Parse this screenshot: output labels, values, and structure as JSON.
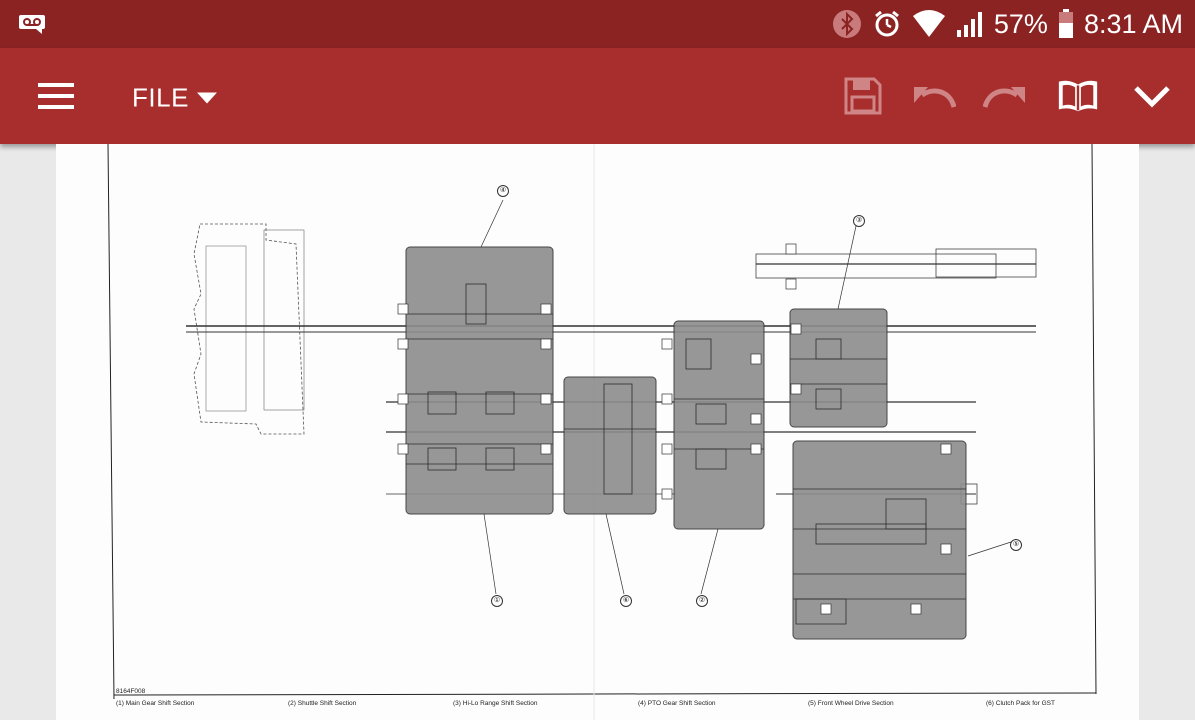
{
  "status_bar": {
    "battery_percent": "57%",
    "time": "8:31 AM",
    "icons": [
      "voicemail-icon",
      "bluetooth-icon",
      "alarm-icon",
      "wifi-icon",
      "signal-icon",
      "battery-icon"
    ]
  },
  "toolbar": {
    "file_label": "FILE",
    "icons": [
      "menu-icon",
      "dropdown-caret-icon",
      "save-icon",
      "undo-icon",
      "redo-icon",
      "book-icon",
      "chevron-down-icon"
    ]
  },
  "document": {
    "figure_code": "8164F008",
    "callouts": [
      "①",
      "②",
      "③",
      "④",
      "⑤",
      "⑥"
    ],
    "captions": [
      "(1)  Main Gear Shift Section",
      "(2)  Shuttle Shift Section",
      "(3)  Hi-Lo Range Shift Section",
      "(4)  PTO Gear Shift Section",
      "(5)  Front Wheel Drive Section",
      "(6)  Clutch Pack for GST"
    ]
  },
  "colors": {
    "status_bar": "#8b2323",
    "app_bar": "#a82e2e",
    "section_fill": "#8c8c8c"
  }
}
